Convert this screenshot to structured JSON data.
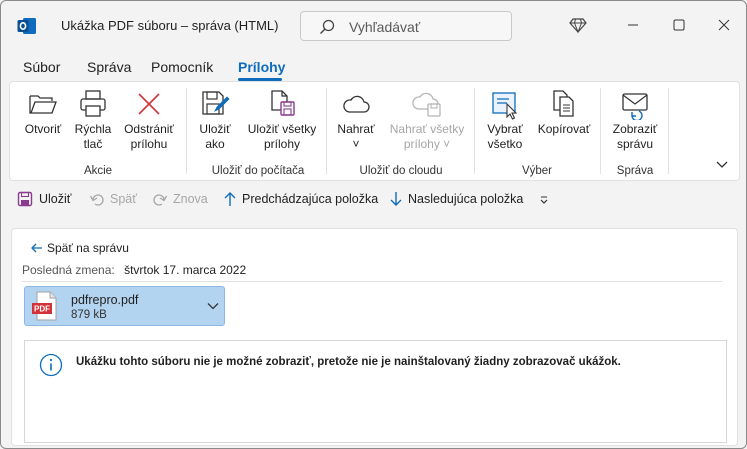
{
  "window": {
    "title": "Ukážka PDF súboru – správa (HTML)",
    "search_placeholder": "Vyhľadávať"
  },
  "tabs": [
    {
      "label": "Súbor"
    },
    {
      "label": "Správa"
    },
    {
      "label": "Pomocník"
    },
    {
      "label": "Prílohy",
      "active": true
    }
  ],
  "ribbon": {
    "groups": {
      "actions": "Akcie",
      "save_pc": "Uložiť do počítača",
      "save_cloud": "Uložiť do cloudu",
      "select": "Výber",
      "message": "Správa"
    },
    "buttons": {
      "open": [
        "Otvoriť"
      ],
      "print": [
        "Rýchla",
        "tlač"
      ],
      "remove": [
        "Odstrániť",
        "prílohu"
      ],
      "save_as": [
        "Uložiť",
        "ako"
      ],
      "save_all": [
        "Uložiť všetky",
        "prílohy"
      ],
      "upload": [
        "Nahrať",
        "˅"
      ],
      "upload_all": [
        "Nahrať všetky",
        "prílohy ˅"
      ],
      "select_all": [
        "Vybrať",
        "všetko"
      ],
      "copy": [
        "Kopírovať"
      ],
      "show_message": [
        "Zobraziť",
        "správu"
      ]
    }
  },
  "qat": {
    "save": "Uložiť",
    "undo": "Späť",
    "redo": "Znova",
    "previous": "Predchádzajúca položka",
    "next": "Nasledujúca položka"
  },
  "content": {
    "back": "Späť na správu",
    "modified_label": "Posledná zmena:",
    "modified_value": "štvrtok 17. marca 2022",
    "attachment": {
      "name": "pdfrepro.pdf",
      "size": "879 kB",
      "badge": "PDF"
    },
    "info": "Ukážku tohto súboru nie je možné zobraziť, pretože nie je nainštalovaný žiadny zobrazovač ukážok."
  },
  "colors": {
    "accent": "#0f6cbd",
    "attachment_bg": "#b3d4f0",
    "pdf_red": "#d13438",
    "save_purple": "#8a3b8f"
  }
}
